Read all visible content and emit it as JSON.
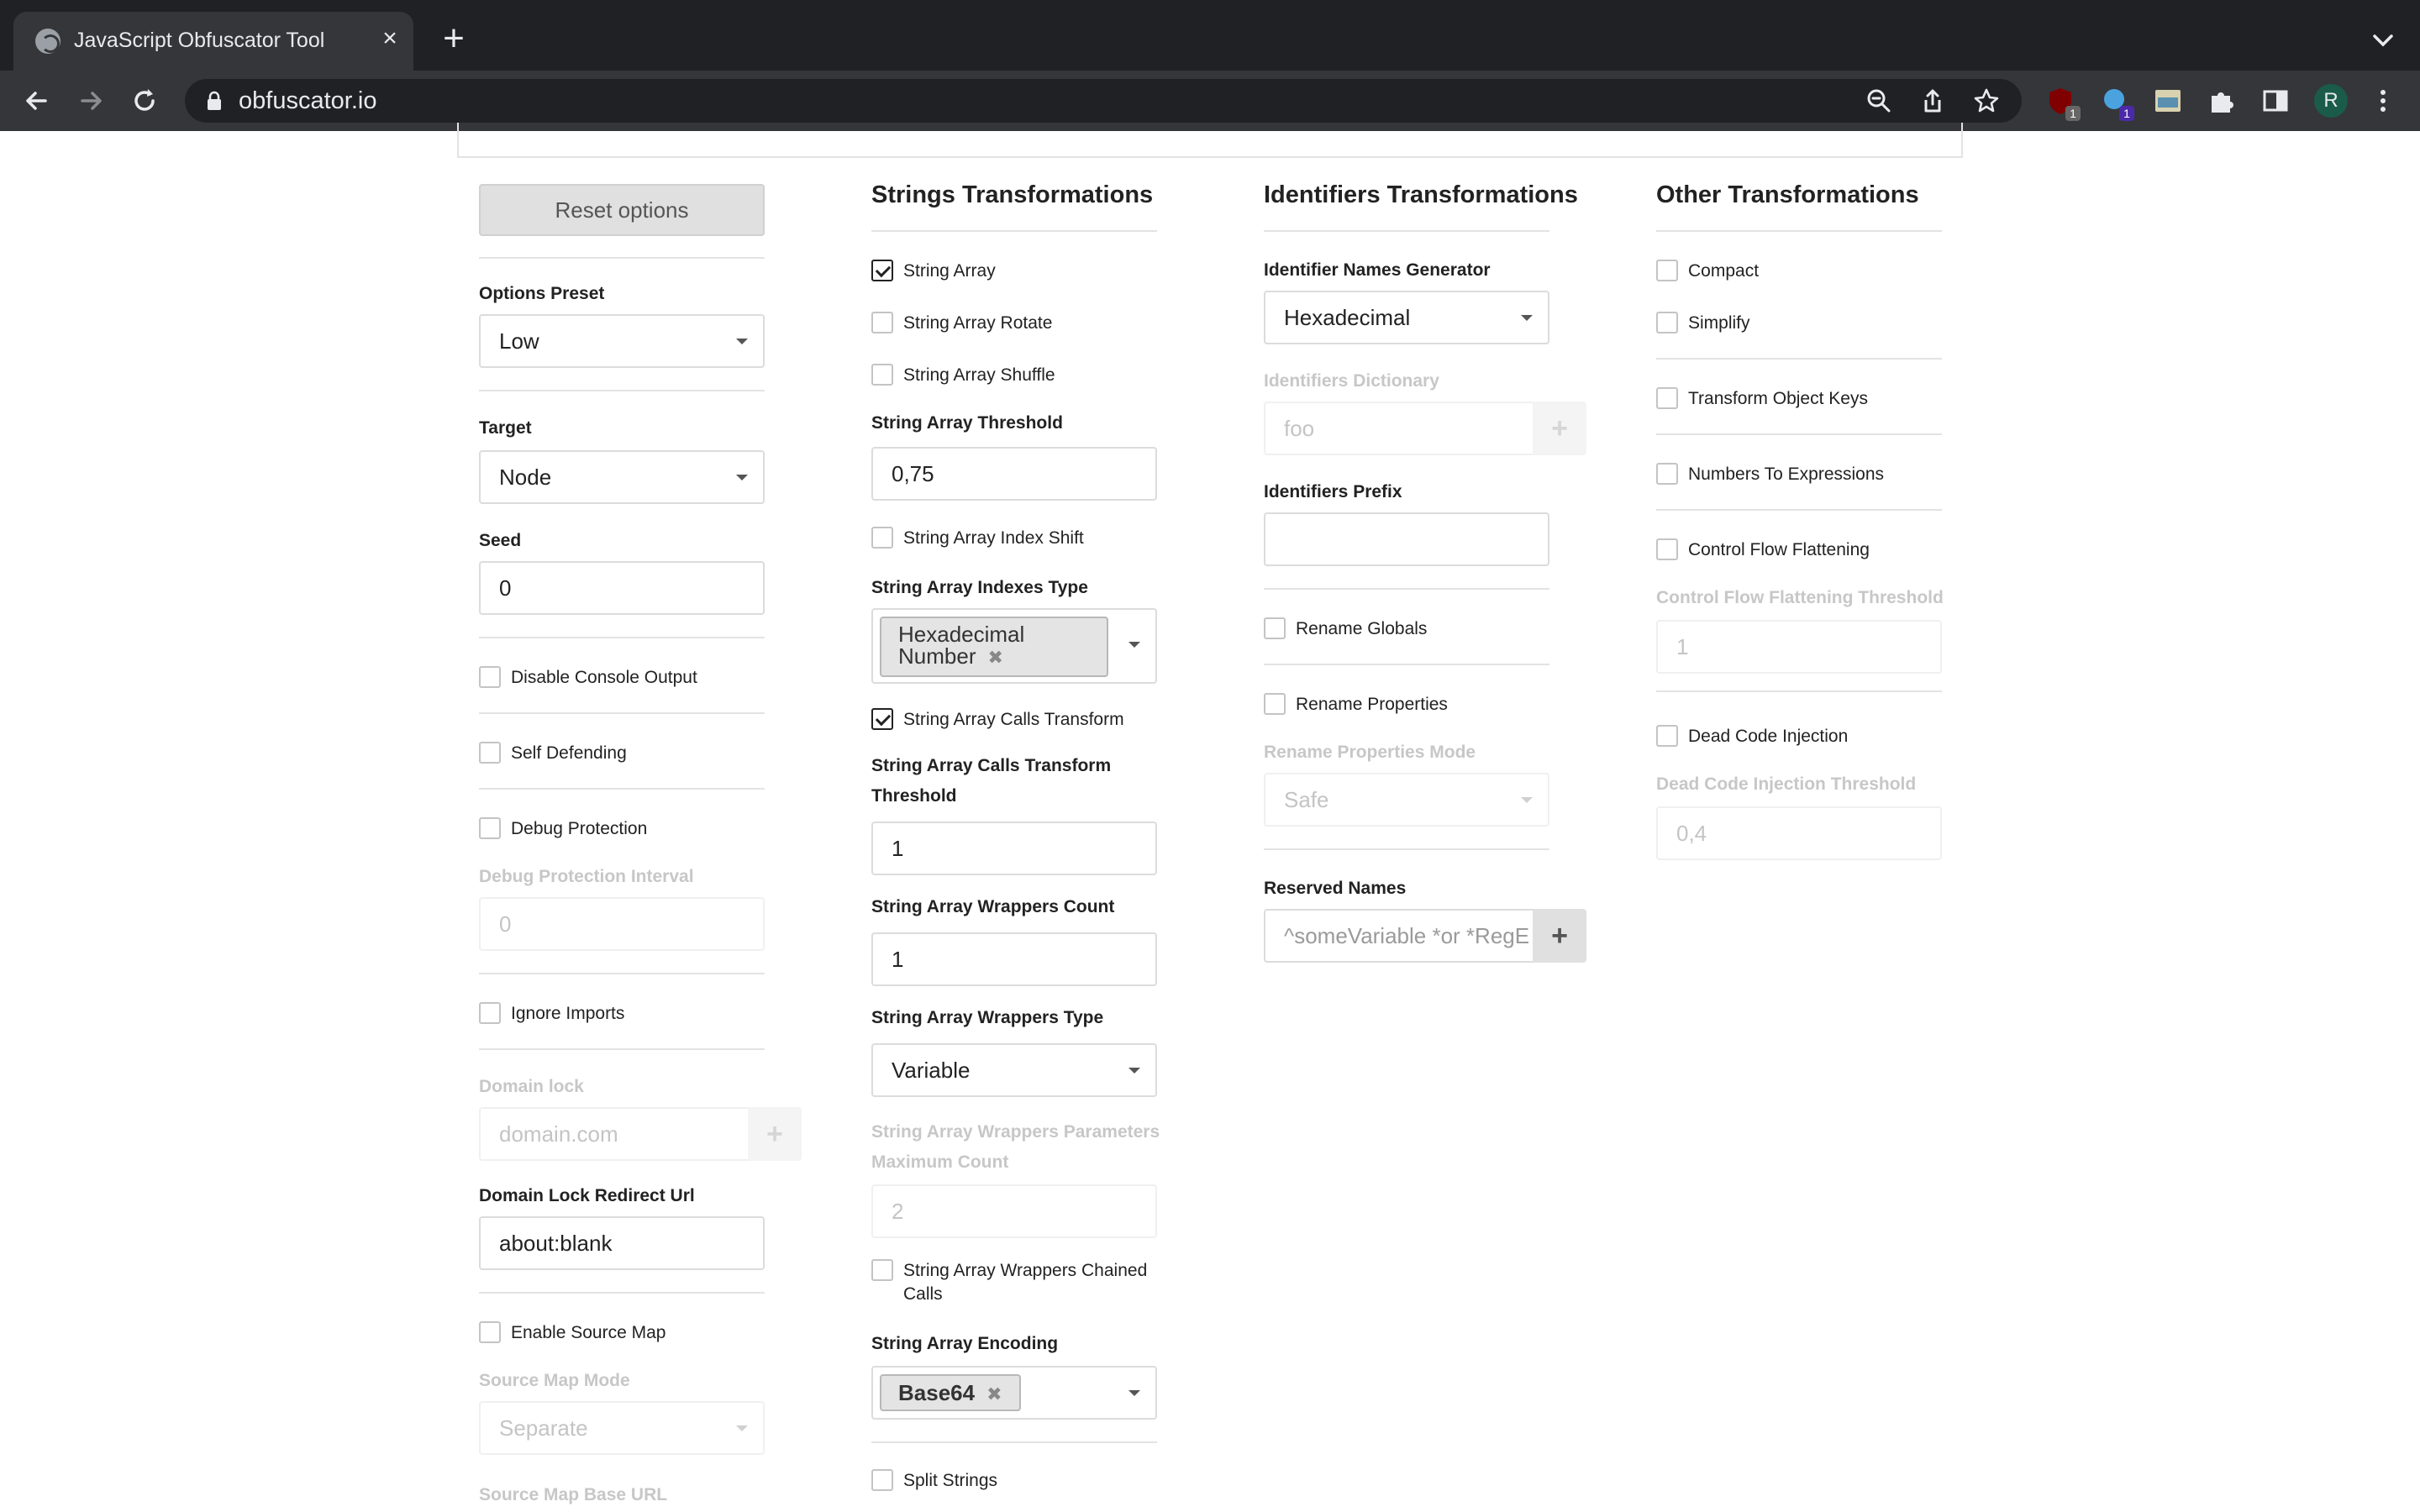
{
  "browser": {
    "tab_title": "JavaScript Obfuscator Tool",
    "url": "obfuscator.io",
    "profile_initial": "R",
    "extensions": [
      {
        "name": "ublock-icon",
        "badge": "1"
      },
      {
        "name": "extension-icon",
        "badge": "1"
      },
      {
        "name": "image-extension-icon",
        "badge": ""
      },
      {
        "name": "puzzle-icon",
        "badge": ""
      },
      {
        "name": "sidepanel-icon",
        "badge": ""
      }
    ]
  },
  "col1": {
    "reset_label": "Reset options",
    "options_preset": {
      "label": "Options Preset",
      "value": "Low"
    },
    "target": {
      "label": "Target",
      "value": "Node"
    },
    "seed": {
      "label": "Seed",
      "value": "0"
    },
    "disable_console_output": {
      "label": "Disable Console Output",
      "checked": false
    },
    "self_defending": {
      "label": "Self Defending",
      "checked": false
    },
    "debug_protection": {
      "label": "Debug Protection",
      "checked": false
    },
    "debug_protection_interval": {
      "label": "Debug Protection Interval",
      "value": "0"
    },
    "ignore_imports": {
      "label": "Ignore Imports",
      "checked": false
    },
    "domain_lock": {
      "label": "Domain lock",
      "placeholder": "domain.com"
    },
    "domain_lock_redirect": {
      "label": "Domain Lock Redirect Url",
      "value": "about:blank"
    },
    "enable_source_map": {
      "label": "Enable Source Map",
      "checked": false
    },
    "source_map_mode": {
      "label": "Source Map Mode",
      "value": "Separate"
    },
    "source_map_base_url": {
      "label": "Source Map Base URL"
    }
  },
  "col2": {
    "title": "Strings Transformations",
    "string_array": {
      "label": "String Array",
      "checked": true
    },
    "string_array_rotate": {
      "label": "String Array Rotate",
      "checked": false
    },
    "string_array_shuffle": {
      "label": "String Array Shuffle",
      "checked": false
    },
    "string_array_threshold": {
      "label": "String Array Threshold",
      "value": "0,75"
    },
    "string_array_index_shift": {
      "label": "String Array Index Shift",
      "checked": false
    },
    "string_array_indexes_type": {
      "label": "String Array Indexes Type",
      "chip_line1": "Hexadecimal",
      "chip_line2": "Number"
    },
    "string_array_calls_transform": {
      "label": "String Array Calls Transform",
      "checked": true
    },
    "calls_transform_threshold": {
      "label_line1": "String Array Calls Transform",
      "label_line2": "Threshold",
      "value": "1"
    },
    "wrappers_count": {
      "label": "String Array Wrappers Count",
      "value": "1"
    },
    "wrappers_type": {
      "label": "String Array Wrappers Type",
      "value": "Variable"
    },
    "wrappers_params_max": {
      "label_line1": "String Array Wrappers Parameters",
      "label_line2": "Maximum Count",
      "value": "2"
    },
    "wrappers_chained_calls": {
      "label_line1": "String Array Wrappers Chained",
      "label_line2": "Calls",
      "checked": false
    },
    "string_array_encoding": {
      "label": "String Array Encoding",
      "chip": "Base64"
    },
    "split_strings": {
      "label": "Split Strings",
      "checked": false
    }
  },
  "col3": {
    "title": "Identifiers Transformations",
    "names_generator": {
      "label": "Identifier Names Generator",
      "value": "Hexadecimal"
    },
    "identifiers_dictionary": {
      "label": "Identifiers Dictionary",
      "placeholder": "foo"
    },
    "identifiers_prefix": {
      "label": "Identifiers Prefix",
      "value": ""
    },
    "rename_globals": {
      "label": "Rename Globals",
      "checked": false
    },
    "rename_properties": {
      "label": "Rename Properties",
      "checked": false
    },
    "rename_properties_mode": {
      "label": "Rename Properties Mode",
      "value": "Safe"
    },
    "reserved_names": {
      "label": "Reserved Names",
      "placeholder": "^someVariable *or *RegE"
    }
  },
  "col4": {
    "title": "Other Transformations",
    "compact": {
      "label": "Compact",
      "checked": false
    },
    "simplify": {
      "label": "Simplify",
      "checked": false
    },
    "transform_object_keys": {
      "label": "Transform Object Keys",
      "checked": false
    },
    "numbers_to_expressions": {
      "label": "Numbers To Expressions",
      "checked": false
    },
    "control_flow_flattening": {
      "label": "Control Flow Flattening",
      "checked": false
    },
    "cff_threshold": {
      "label": "Control Flow Flattening Threshold",
      "value": "1"
    },
    "dead_code_injection": {
      "label": "Dead Code Injection",
      "checked": false
    },
    "dci_threshold": {
      "label": "Dead Code Injection Threshold",
      "value": "0,4"
    }
  }
}
